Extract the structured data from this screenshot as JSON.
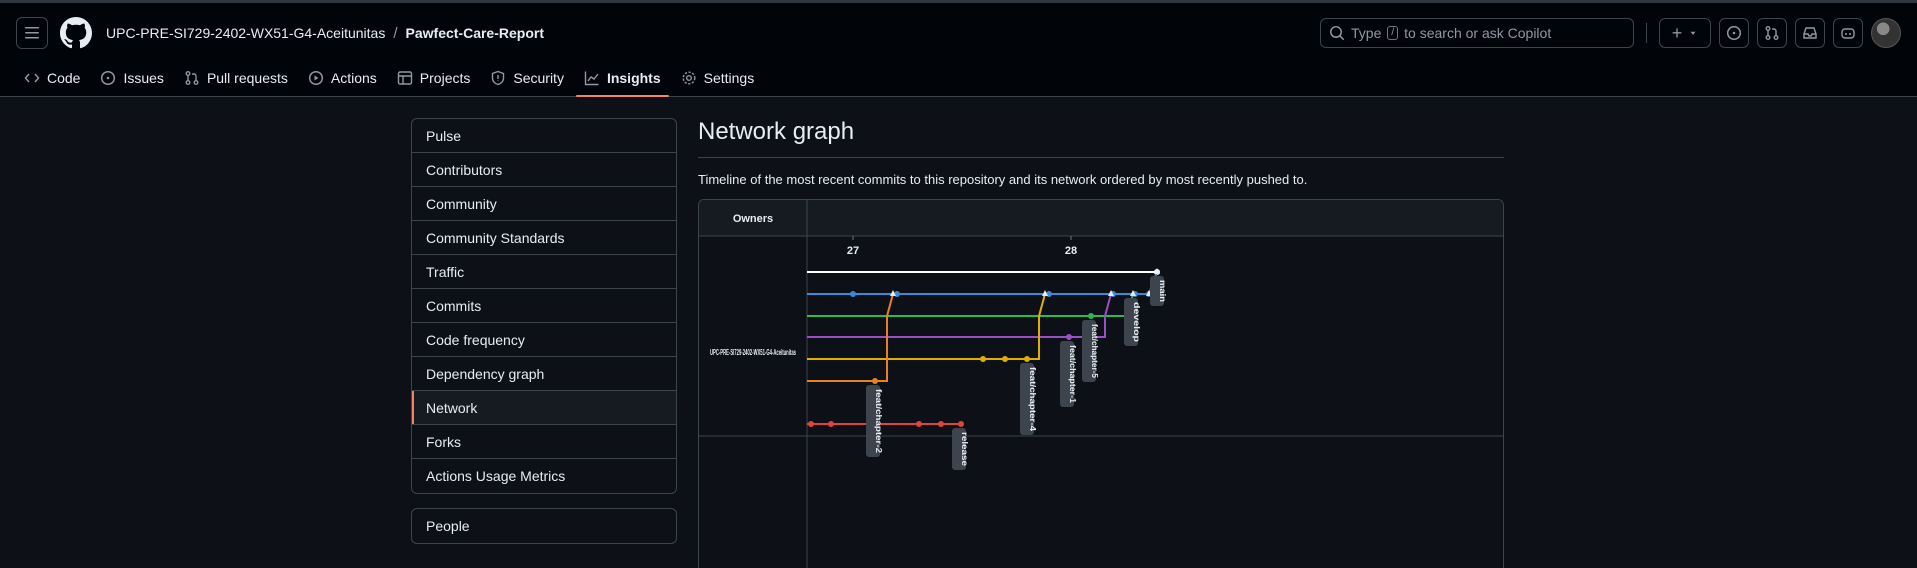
{
  "header": {
    "owner": "UPC-PRE-SI729-2402-WX51-G4-Aceitunitas",
    "separator": "/",
    "repo": "Pawfect-Care-Report",
    "search_pre": "Type",
    "search_key": "/",
    "search_post": "to search or ask Copilot",
    "plus": "+"
  },
  "tabs": [
    {
      "label": "Code",
      "icon": "code-icon"
    },
    {
      "label": "Issues",
      "icon": "issue-icon"
    },
    {
      "label": "Pull requests",
      "icon": "pull-request-icon"
    },
    {
      "label": "Actions",
      "icon": "play-icon"
    },
    {
      "label": "Projects",
      "icon": "table-icon"
    },
    {
      "label": "Security",
      "icon": "shield-icon"
    },
    {
      "label": "Insights",
      "icon": "graph-icon",
      "active": true
    },
    {
      "label": "Settings",
      "icon": "gear-icon"
    }
  ],
  "sidebar": {
    "items": [
      "Pulse",
      "Contributors",
      "Community",
      "Community Standards",
      "Traffic",
      "Commits",
      "Code frequency",
      "Dependency graph",
      "Network",
      "Forks",
      "Actions Usage Metrics"
    ],
    "selected": "Network",
    "people": "People"
  },
  "main": {
    "title": "Network graph",
    "description": "Timeline of the most recent commits to this repository and its network ordered by most recently pushed to."
  },
  "graph": {
    "owners_header": "Owners",
    "owner_label": "UPC-PRE-SI729-2402-WX51-G4-Aceitunitas",
    "dates": [
      "27",
      "28"
    ],
    "branches": [
      {
        "name": "main",
        "color": "#ffffff"
      },
      {
        "name": "develop",
        "color": "#3b8ad8"
      },
      {
        "name": "feat/chapter-5",
        "color": "#2dba4e"
      },
      {
        "name": "feat/chapter-1",
        "color": "#9b4fc7"
      },
      {
        "name": "feat/chapter-4",
        "color": "#e0b000"
      },
      {
        "name": "feat/chapter-2",
        "color": "#e8821f"
      },
      {
        "name": "release",
        "color": "#e0453a"
      }
    ]
  }
}
